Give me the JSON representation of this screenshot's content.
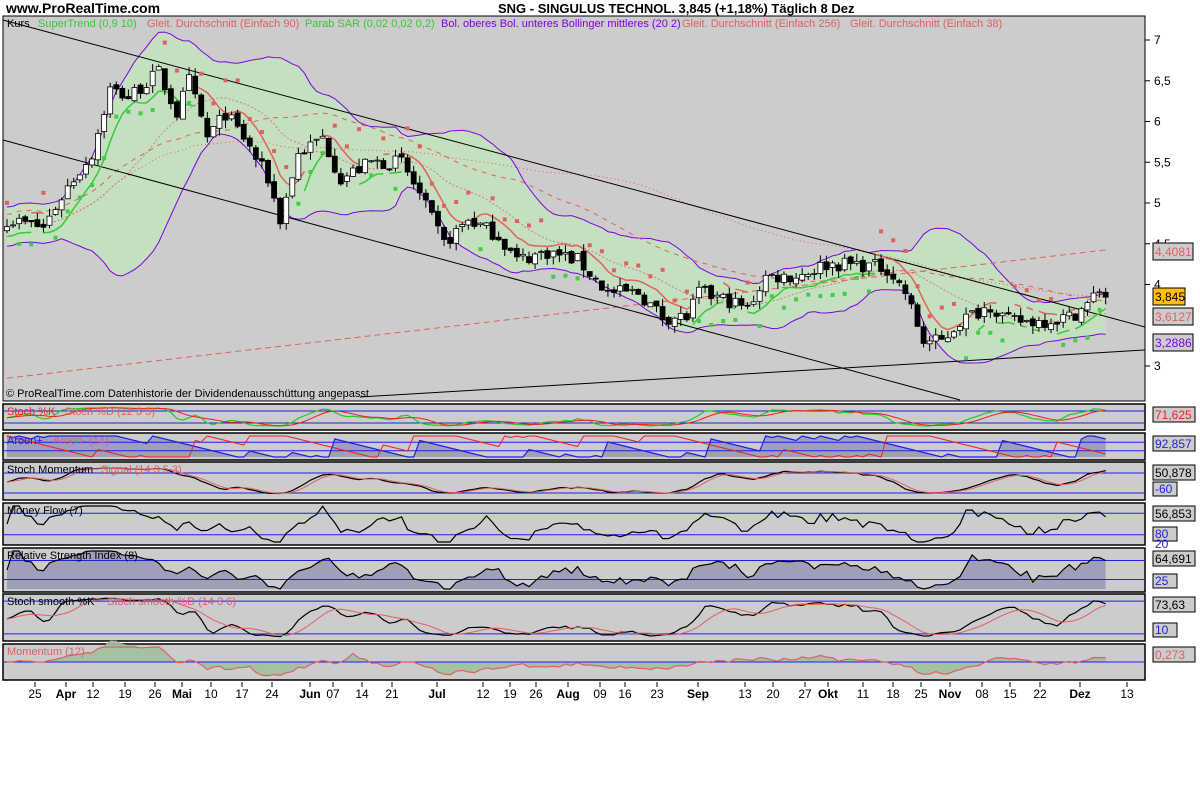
{
  "header": {
    "site": "www.ProRealTime.com",
    "title": "SNG - SINGULUS TECHNOL.   3,845 (+1,18%)   Täglich  8 Dez"
  },
  "legend": {
    "kurs": "Kurs",
    "supertrend": "SuperTrend (0,9 10)",
    "ma90": "Gleit. Durchschnitt (Einfach 90)",
    "sar": "Parab SAR (0,02 0,02 0,2)",
    "boll": "Bol. oberes Bol. unteres Bollinger mittleres (20 2)",
    "ma256": "Gleit. Durchschnitt (Einfach 256)",
    "ma38": "Gleit. Durchschnitt (Einfach 38)"
  },
  "footer_note": "© ProRealTime.com  Datenhistorie der Dividendenausschüttung angepasst",
  "colors": {
    "panel": "#cccccc",
    "green": "#33cc33",
    "red": "#e06060",
    "purple": "#8000e0",
    "blue": "#2020e0",
    "band": "#c4e0c0",
    "last": "#ffc000"
  },
  "chart_data": {
    "type": "candlestick",
    "title": "SNG - SINGULUS TECHNOL.",
    "ylim": [
      2.7,
      7.3
    ],
    "yticks": [
      "7",
      "6,5",
      "6",
      "5,5",
      "5",
      "4,5",
      "4",
      "3"
    ],
    "ytick_values": [
      7,
      6.5,
      6,
      5.5,
      5,
      4.5,
      4,
      3
    ],
    "price_path": [
      [
        0,
        4.8
      ],
      [
        6,
        4.7
      ],
      [
        10,
        5.2
      ],
      [
        14,
        5.6
      ],
      [
        17,
        6.4
      ],
      [
        20,
        6.3
      ],
      [
        25,
        6.6
      ],
      [
        28,
        6.1
      ],
      [
        30,
        6.5
      ],
      [
        33,
        5.8
      ],
      [
        36,
        6.1
      ],
      [
        39,
        5.8
      ],
      [
        43,
        5.3
      ],
      [
        45,
        4.8
      ],
      [
        48,
        5.6
      ],
      [
        52,
        5.8
      ],
      [
        55,
        5.3
      ],
      [
        60,
        5.5
      ],
      [
        65,
        5.5
      ],
      [
        68,
        5.1
      ],
      [
        72,
        4.5
      ],
      [
        76,
        4.8
      ],
      [
        81,
        4.6
      ],
      [
        84,
        4.3
      ],
      [
        89,
        4.4
      ],
      [
        94,
        4.3
      ],
      [
        99,
        3.9
      ],
      [
        104,
        3.9
      ],
      [
        108,
        3.6
      ],
      [
        112,
        3.6
      ],
      [
        114,
        3.9
      ],
      [
        119,
        3.8
      ],
      [
        122,
        3.7
      ],
      [
        125,
        4.1
      ],
      [
        130,
        4.1
      ],
      [
        135,
        4.25
      ],
      [
        140,
        4.25
      ],
      [
        145,
        4.2
      ],
      [
        148,
        3.9
      ],
      [
        151,
        3.3
      ],
      [
        154,
        3.3
      ],
      [
        157,
        3.55
      ],
      [
        162,
        3.75
      ],
      [
        165,
        3.55
      ],
      [
        170,
        3.55
      ],
      [
        175,
        3.6
      ],
      [
        178,
        3.75
      ],
      [
        180,
        3.95
      ],
      [
        181,
        3.845
      ]
    ],
    "x_ticks": [
      {
        "label": "25",
        "bold": false,
        "x": 35
      },
      {
        "label": "Apr",
        "bold": true,
        "x": 66
      },
      {
        "label": "12",
        "bold": false,
        "x": 93
      },
      {
        "label": "19",
        "bold": false,
        "x": 125
      },
      {
        "label": "26",
        "bold": false,
        "x": 155
      },
      {
        "label": "Mai",
        "bold": true,
        "x": 182
      },
      {
        "label": "10",
        "bold": false,
        "x": 211
      },
      {
        "label": "17",
        "bold": false,
        "x": 242
      },
      {
        "label": "24",
        "bold": false,
        "x": 272
      },
      {
        "label": "Jun",
        "bold": true,
        "x": 310
      },
      {
        "label": "07",
        "bold": false,
        "x": 333
      },
      {
        "label": "14",
        "bold": false,
        "x": 362
      },
      {
        "label": "21",
        "bold": false,
        "x": 392
      },
      {
        "label": "Jul",
        "bold": true,
        "x": 437
      },
      {
        "label": "12",
        "bold": false,
        "x": 483
      },
      {
        "label": "19",
        "bold": false,
        "x": 510
      },
      {
        "label": "26",
        "bold": false,
        "x": 536
      },
      {
        "label": "Aug",
        "bold": true,
        "x": 568
      },
      {
        "label": "09",
        "bold": false,
        "x": 600
      },
      {
        "label": "16",
        "bold": false,
        "x": 625
      },
      {
        "label": "23",
        "bold": false,
        "x": 657
      },
      {
        "label": "Sep",
        "bold": true,
        "x": 698
      },
      {
        "label": "13",
        "bold": false,
        "x": 745
      },
      {
        "label": "20",
        "bold": false,
        "x": 773
      },
      {
        "label": "27",
        "bold": false,
        "x": 805
      },
      {
        "label": "Okt",
        "bold": true,
        "x": 828
      },
      {
        "label": "11",
        "bold": false,
        "x": 863
      },
      {
        "label": "18",
        "bold": false,
        "x": 893
      },
      {
        "label": "25",
        "bold": false,
        "x": 921
      },
      {
        "label": "Nov",
        "bold": true,
        "x": 950
      },
      {
        "label": "08",
        "bold": false,
        "x": 982
      },
      {
        "label": "15",
        "bold": false,
        "x": 1010
      },
      {
        "label": "22",
        "bold": false,
        "x": 1040
      },
      {
        "label": "Dez",
        "bold": true,
        "x": 1080
      },
      {
        "label": "13",
        "bold": false,
        "x": 1127
      }
    ],
    "last_values": {
      "ma256": "4,4081",
      "close": "3,845",
      "ma38": "3,6127",
      "boll_lower": "3,2886"
    },
    "indicators": [
      {
        "id": "stoch",
        "label": "Stoch %K",
        "label2": "Stoch %D (12 3 5)",
        "value": "71,625",
        "value_color": "#ee2020",
        "levels": [
          20,
          80
        ]
      },
      {
        "id": "aroon",
        "label": "Aroon+",
        "label2": "Aroon- (14)",
        "value": "92,857",
        "value_color": "#2020e0",
        "levels": [
          30,
          70
        ]
      },
      {
        "id": "smom",
        "label": "Stoch Momentum",
        "label2": "Signal (14 3 5 3)",
        "value": "50,878",
        "value_color": "#000000",
        "levels": [
          -60,
          40
        ],
        "extra": "-60"
      },
      {
        "id": "mfi",
        "label": "Money Flow (7)",
        "label2": "",
        "value": "56,853",
        "value_color": "#000000",
        "levels": [
          20,
          80
        ],
        "extra": "80",
        "extra2": "20"
      },
      {
        "id": "rsi",
        "label": "Relative Strength Index (8)",
        "label2": "",
        "value": "64,691",
        "value_color": "#000000",
        "levels": [
          25,
          75
        ],
        "extra": "25"
      },
      {
        "id": "ssmooth",
        "label": "Stoch smooth %K",
        "label2": "Stoch smooth %D (14 3 6)",
        "value": "73,63",
        "value_color": "#000000",
        "levels": [
          10,
          90
        ],
        "extra": "10"
      },
      {
        "id": "mom",
        "label": "Momentum (12)",
        "label2": "",
        "value": "0,273",
        "value_color": "#e06060",
        "levels": [
          0
        ]
      }
    ]
  }
}
